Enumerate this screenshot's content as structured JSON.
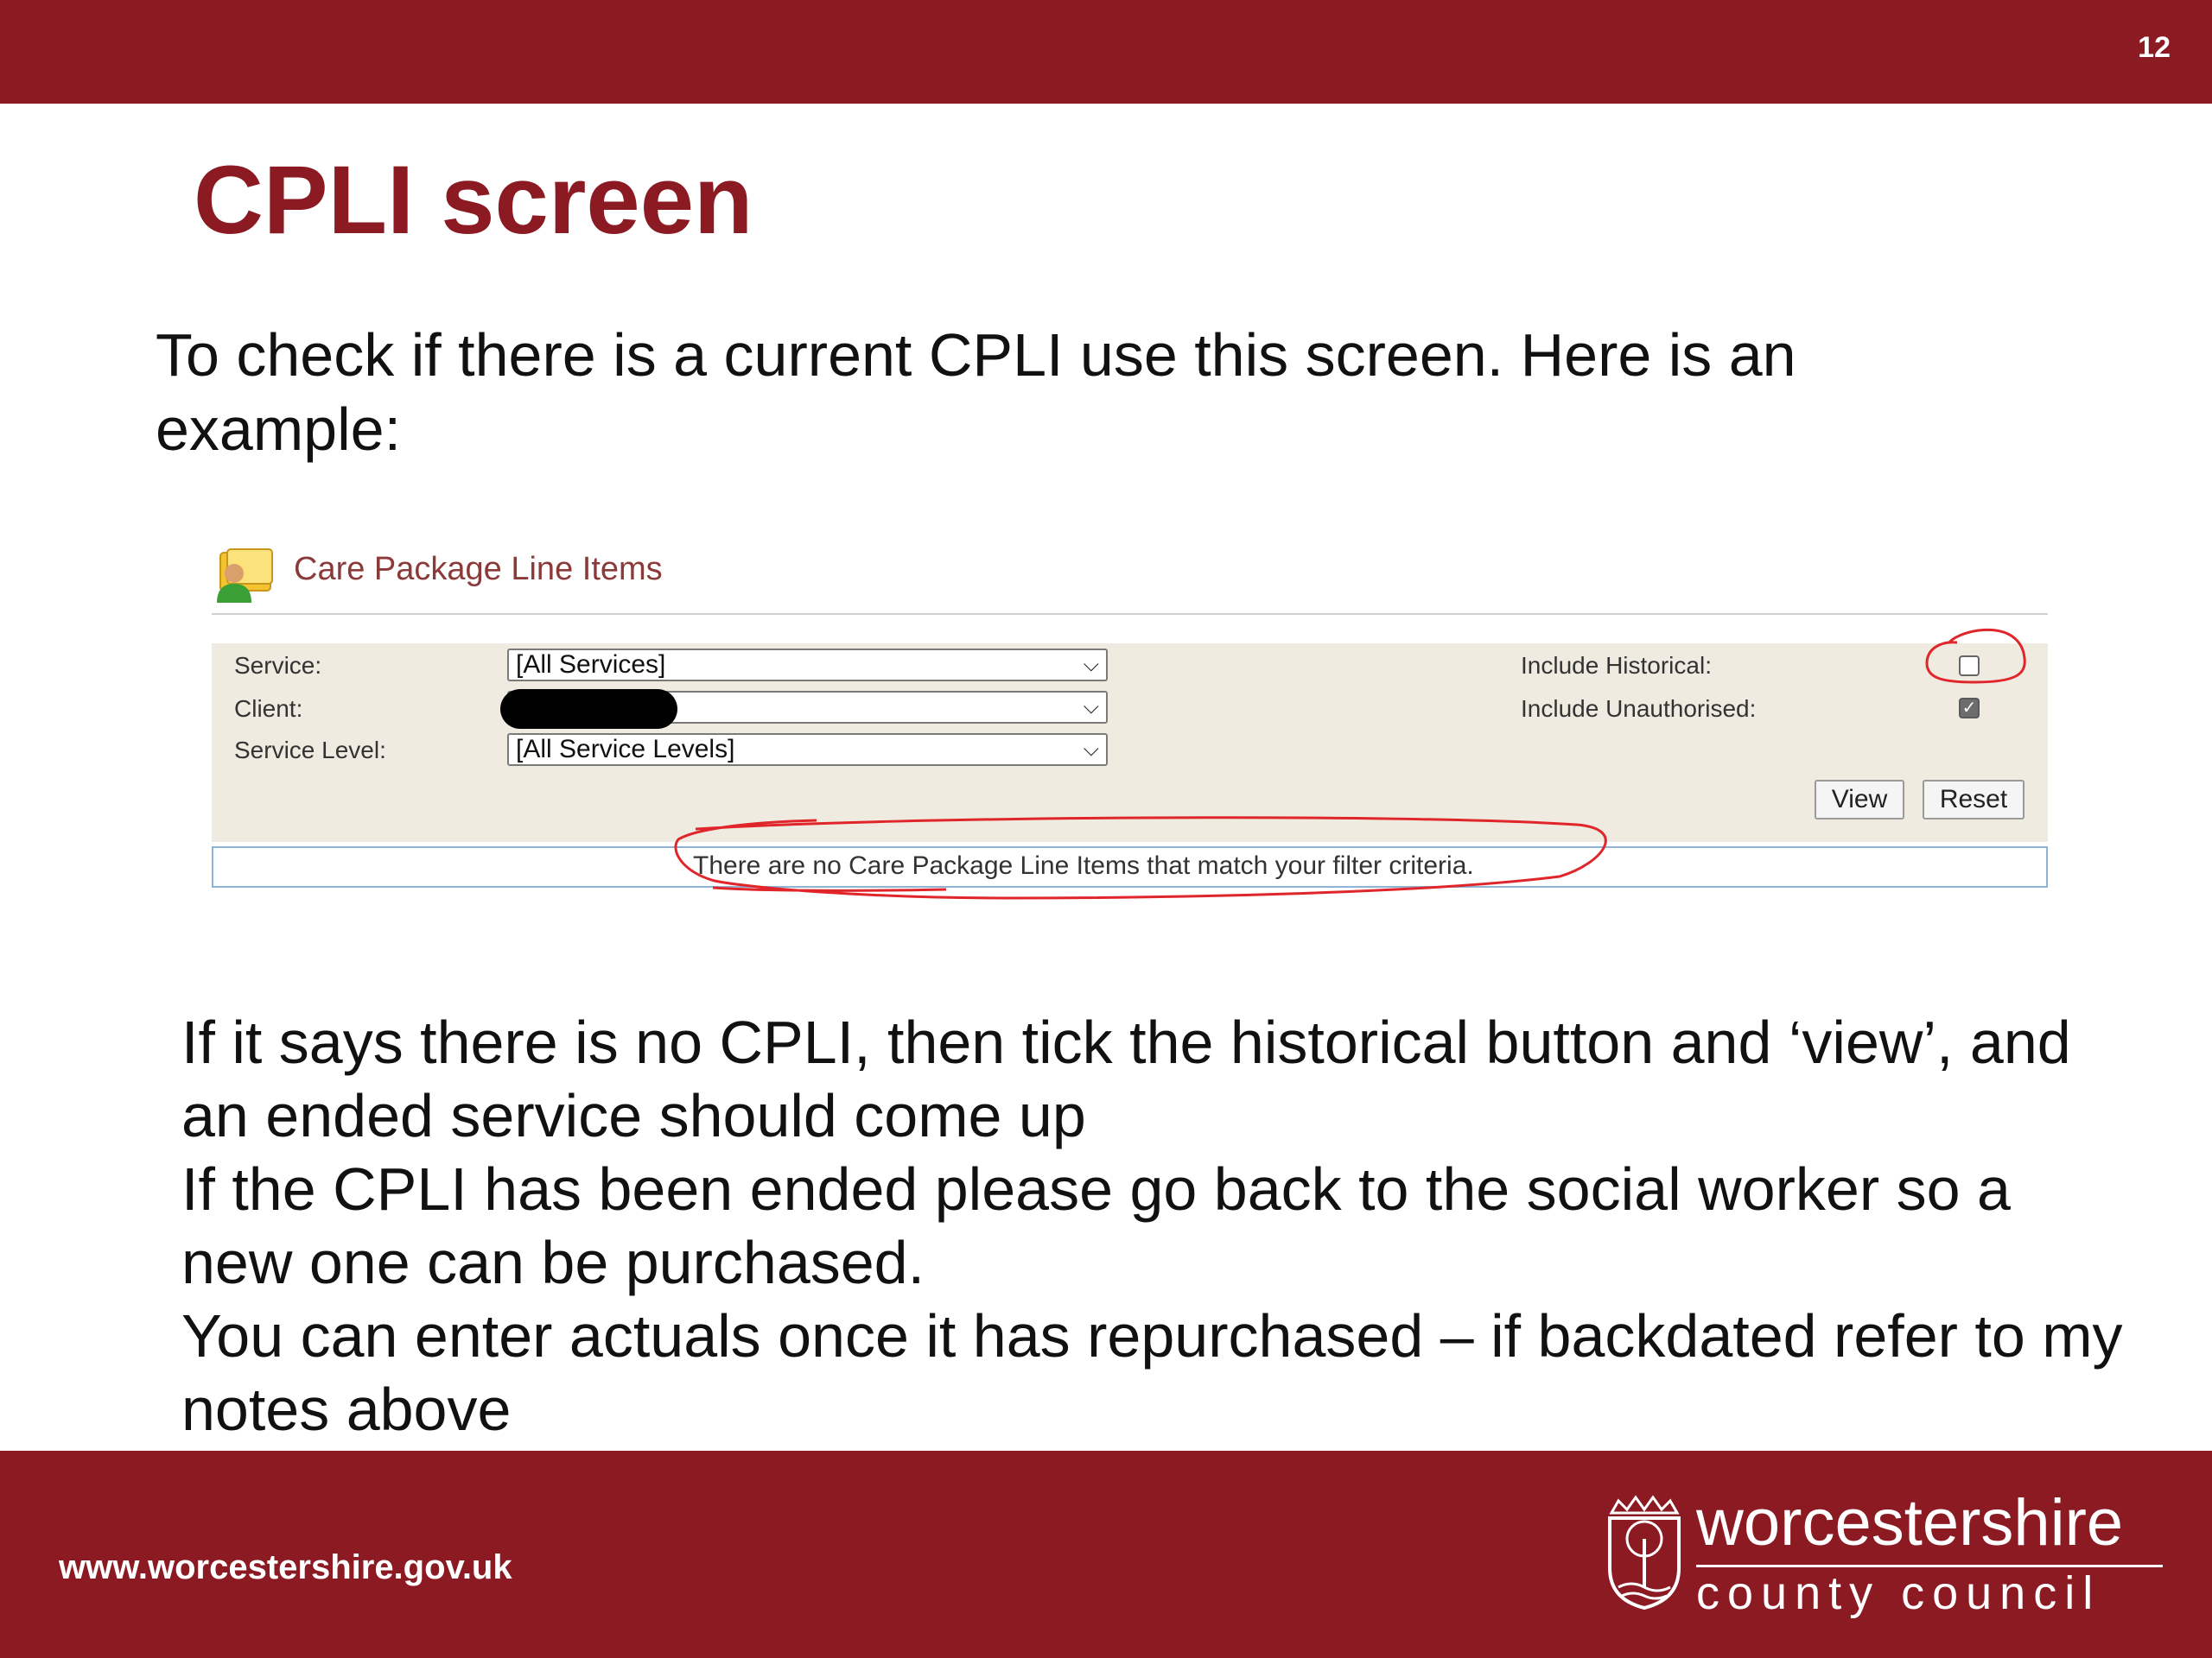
{
  "slide": {
    "number": "12",
    "title": "CPLI screen",
    "intro": "To check if there is a current CPLI use this screen. Here is an example:",
    "body": [
      "If it says there is no CPLI, then tick the historical button and ‘view’, and an ended service should come up",
      "If the CPLI has been ended please go back to the social worker so a new one can be purchased.",
      "You can enter actuals once it has repurchased – if backdated refer to my notes above"
    ]
  },
  "screenshot": {
    "title": "Care Package Line Items",
    "icon": "user-folder-icon",
    "filters": {
      "service_label": "Service:",
      "service_value": "[All Services]",
      "client_label": "Client:",
      "client_value": "",
      "service_level_label": "Service Level:",
      "service_level_value": "[All Service Levels]",
      "include_historical_label": "Include Historical:",
      "include_historical_checked": false,
      "include_unauthorised_label": "Include Unauthorised:",
      "include_unauthorised_checked": true
    },
    "buttons": {
      "view": "View",
      "reset": "Reset"
    },
    "message": "There are no Care Package Line Items that match your filter criteria."
  },
  "footer": {
    "url": "www.worcestershire.gov.uk",
    "logo_line1": "worcestershire",
    "logo_line2": "county council"
  },
  "colors": {
    "brand": "#8b1a22",
    "annotation": "#e0262b"
  }
}
